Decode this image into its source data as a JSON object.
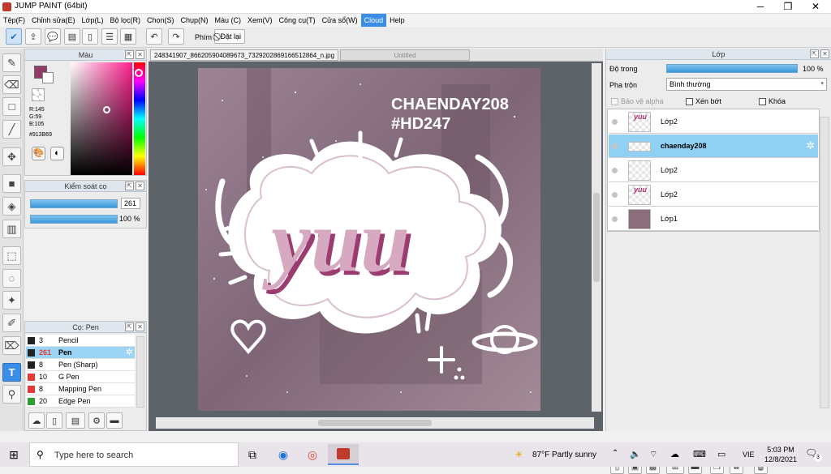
{
  "window": {
    "title": "JUMP PAINT (64bit)",
    "minimize": "─",
    "maximize": "❐",
    "close": "✕"
  },
  "menu": [
    "Tệp(F)",
    "Chỉnh sửa(E)",
    "Lớp(L)",
    "Bộ lọc(R)",
    "Chọn(S)",
    "Chụp(N)",
    "Màu (C)",
    "Xem(V)",
    "Công cụ(T)",
    "Cửa sổ(W)",
    "Cloud",
    "Help"
  ],
  "toolbar": {
    "phim_label": "Phím",
    "reset_label": "Đặt lại"
  },
  "color_panel": {
    "title": "Màu",
    "r": "R:145",
    "g": "G:59",
    "b": "B:105",
    "hex": "#913B69",
    "main_color": "#913b69"
  },
  "brush_control": {
    "title": "Kiểm soát cọ",
    "size": "261",
    "opacity": "100 %"
  },
  "brush_panel": {
    "title": "Cọ: Pen",
    "items": [
      {
        "size": "3",
        "name": "Pencil",
        "color": "#222222"
      },
      {
        "size": "261",
        "name": "Pen",
        "color": "#222222"
      },
      {
        "size": "8",
        "name": "Pen (Sharp)",
        "color": "#222222"
      },
      {
        "size": "10",
        "name": "G Pen",
        "color": "#e53935"
      },
      {
        "size": "8",
        "name": "Mapping Pen",
        "color": "#e53935"
      },
      {
        "size": "20",
        "name": "Edge Pen",
        "color": "#2e9e2e"
      }
    ]
  },
  "tabs": {
    "file": "248341907_866205904089673_7329202869166512864_n.jpg",
    "untitled": "Untitled"
  },
  "artwork": {
    "line1": "CHAENDAY208",
    "line2": "#HD247",
    "word": "yuu"
  },
  "layer_panel": {
    "title": "Lớp",
    "opacity_label": "Độ trong",
    "opacity_value": "100 %",
    "blend_label": "Pha trộn",
    "blend_value": "Bình thường",
    "protect_alpha": "Bảo vệ alpha",
    "clip": "Xén bớt",
    "lock": "Khóa",
    "layers": [
      "Lớp2",
      "chaenday208",
      "Lớp2",
      "Lớp2",
      "Lớp1"
    ]
  },
  "taskbar": {
    "search_placeholder": "Type here to search",
    "weather": "87°F  Partly sunny",
    "lang": "VIE",
    "time": "5:03 PM",
    "date": "12/8/2021",
    "notif_count": "3"
  }
}
